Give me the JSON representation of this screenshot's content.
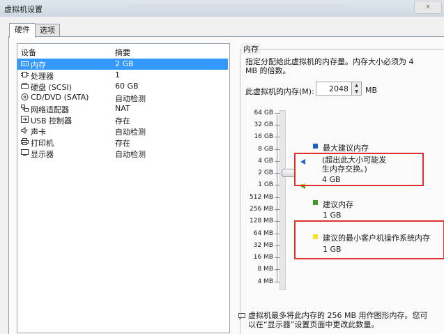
{
  "window": {
    "title": "虚拟机设置",
    "close": "x"
  },
  "tabs": [
    {
      "label": "硬件"
    },
    {
      "label": "选项"
    }
  ],
  "device_list": {
    "col_device": "设备",
    "col_summary": "摘要",
    "rows": [
      {
        "name": "内存",
        "summary": "2 GB",
        "icon": "memory-icon"
      },
      {
        "name": "处理器",
        "summary": "1",
        "icon": "processor-icon"
      },
      {
        "name": "硬盘 (SCSI)",
        "summary": "60 GB",
        "icon": "hard-disk-icon"
      },
      {
        "name": "CD/DVD (SATA)",
        "summary": "自动检测",
        "icon": "cd-dvd-icon"
      },
      {
        "name": "网络适配器",
        "summary": "NAT",
        "icon": "network-adapter-icon"
      },
      {
        "name": "USB 控制器",
        "summary": "存在",
        "icon": "usb-icon"
      },
      {
        "name": "声卡",
        "summary": "自动检测",
        "icon": "speaker-icon"
      },
      {
        "name": "打印机",
        "summary": "存在",
        "icon": "printer-icon"
      },
      {
        "name": "显示器",
        "summary": "自动检测",
        "icon": "display-icon"
      }
    ]
  },
  "memory": {
    "group_title": "内存",
    "description": "指定分配给此虚拟机的内存量。内存大小必须为 4 MB 的倍数。",
    "field_label": "此虚拟机的内存(M):",
    "value": "2048",
    "unit": "MB",
    "scale_ticks": [
      "64 GB",
      "32 GB",
      "16 GB",
      "8 GB",
      "4 GB",
      "2 GB",
      "1 GB",
      "512 MB",
      "256 MB",
      "128 MB",
      "64 MB",
      "32 MB",
      "16 MB",
      "8 MB",
      "4 MB"
    ],
    "slider_value": "2 GB",
    "legend": {
      "max_title": "最大建议内存",
      "max_note": "(超出此大小可能发生内存交换。)",
      "max_value": "4 GB",
      "rec_title": "建议内存",
      "rec_value": "1 GB",
      "min_title": "建议的最小客户机操作系统内存",
      "min_value": "1 GB"
    },
    "colors": {
      "max": "#1f5fbf",
      "recommended": "#3f9a2a",
      "minimum": "#f3e42c",
      "highlight": "#e03030"
    },
    "note": "虚拟机最多将此内存的 256 MB 用作图形内存。您可以在“显示器”设置页面中更改此数量。"
  }
}
